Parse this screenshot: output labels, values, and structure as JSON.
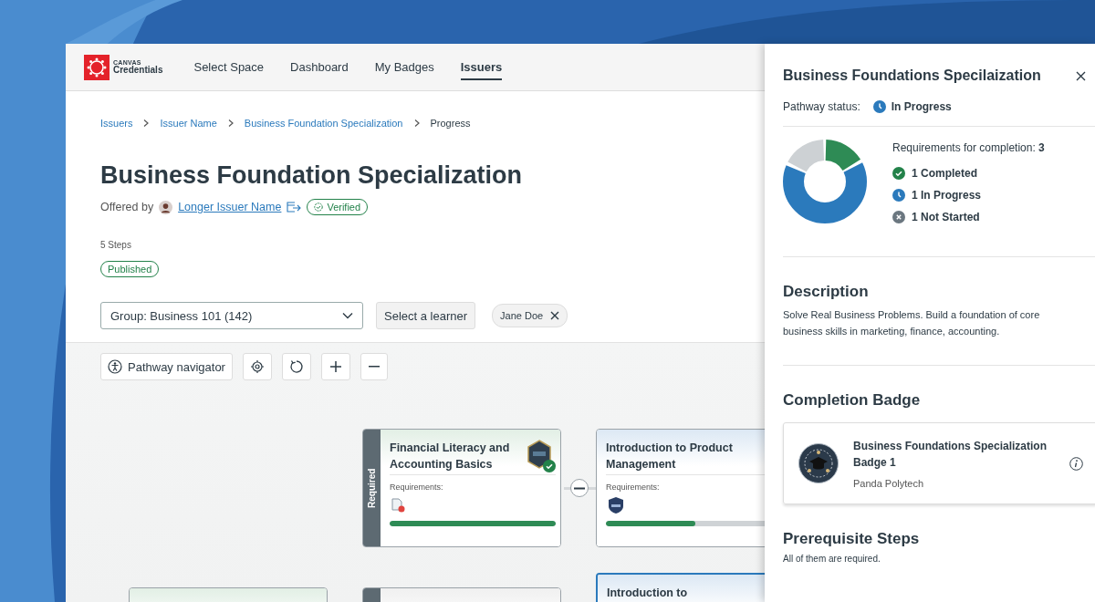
{
  "brand": {
    "line1": "CANVAS",
    "line2": "Credentials"
  },
  "nav": [
    {
      "label": "Select Space",
      "selected": false
    },
    {
      "label": "Dashboard",
      "selected": false
    },
    {
      "label": "My Badges",
      "selected": false
    },
    {
      "label": "Issuers",
      "selected": true
    }
  ],
  "breadcrumbs": [
    {
      "label": "Issuers",
      "kind": "link"
    },
    {
      "label": "Issuer Name",
      "kind": "link"
    },
    {
      "label": "Business Foundation Specialization",
      "kind": "link"
    },
    {
      "label": "Progress",
      "kind": "current"
    }
  ],
  "page": {
    "title": "Business Foundation Specialization",
    "offered_by": "Offered by",
    "issuer": "Longer Issuer Name",
    "verified": "Verified",
    "steps": "5 Steps",
    "status": "Published"
  },
  "filters": {
    "group": "Group: Business 101 (142)",
    "learner_button": "Select a learner",
    "chip": "Jane Doe"
  },
  "toolbar": {
    "navigator": "Pathway navigator"
  },
  "steps": [
    {
      "title": "Financial Literacy and Accounting Basics",
      "required": true,
      "required_label": "Required",
      "kind": "completed",
      "requirements_label": "Requirements:",
      "requirements": [
        {
          "kind": "document"
        }
      ],
      "level": 1,
      "selected": false
    },
    {
      "title": "Introduction to Product Management",
      "required": false,
      "kind": "in_progress",
      "requirements_label": "Requirements:",
      "requirements": [
        {
          "kind": "badge"
        }
      ],
      "level": 0.5,
      "selected": false
    },
    {
      "required": false,
      "kind": "completed",
      "selected": false
    },
    {
      "required": true,
      "kind": "not_started",
      "selected": false
    },
    {
      "title": "Introduction to",
      "required": false,
      "kind": "in_progress",
      "selected": true
    }
  ],
  "panel": {
    "title": "Business Foundations Specilaization",
    "status_label": "Pathway status:",
    "status": {
      "label": "In Progress",
      "kind": "in_progress"
    },
    "requirements": "Requirements for completion: **3**",
    "legend": [
      {
        "kind": "completed",
        "label": "1 Completed"
      },
      {
        "kind": "in_progress",
        "label": "1 In Progress"
      },
      {
        "kind": "not_started",
        "label": "1 Not Started"
      }
    ],
    "description_heading": "Description",
    "description": "Solve Real Business Problems. Build a foundation of core business skills in marketing, finance, accounting.",
    "completion_heading": "Completion Badge",
    "badge": {
      "name": "Business Foundations Specialization Badge 1",
      "issuer": "Panda Polytech"
    },
    "prereq_heading": "Prerequisite Steps",
    "prereq_text": "All of them are required."
  }
}
